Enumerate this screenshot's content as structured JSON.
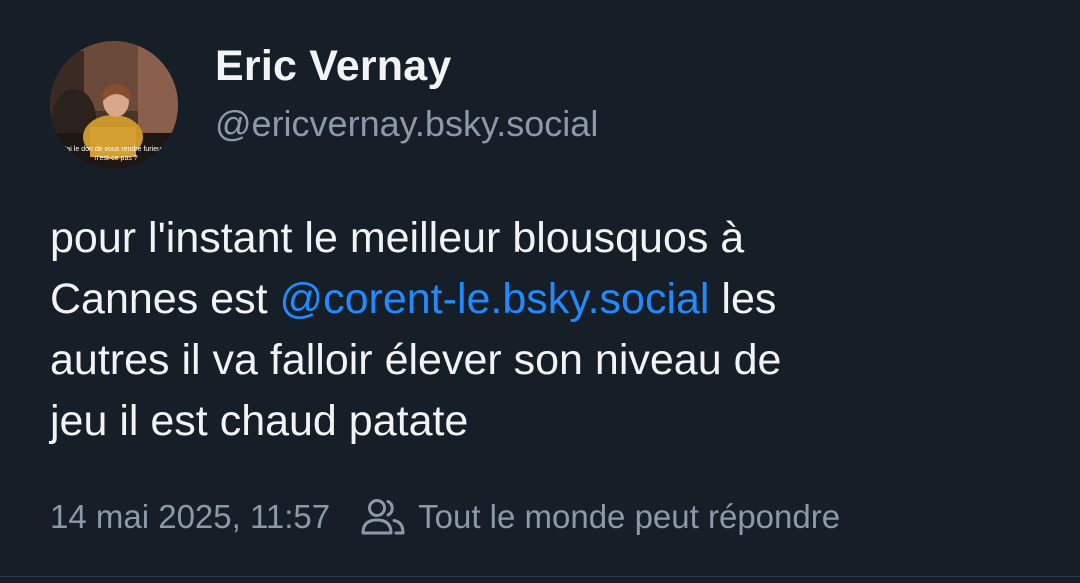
{
  "author": {
    "display_name": "Eric Vernay",
    "handle": "@ericvernay.bsky.social",
    "avatar_caption_line1": "J'ai le don de vous rendre furieux,",
    "avatar_caption_line2": "n'est-ce pas ?"
  },
  "post": {
    "text_line1": "pour l'instant le meilleur blousquos à",
    "text_line2_before": "Cannes est ",
    "mention": "@corent-le.bsky.social",
    "text_line2_after": " les",
    "text_line3": "autres il va falloir élever son niveau de",
    "text_line4": "jeu il est chaud patate"
  },
  "meta": {
    "timestamp": "14 mai 2025, 11:57",
    "reply_setting": "Tout le monde peut répondre",
    "reply_icon": "people-icon"
  },
  "colors": {
    "background": "#161e27",
    "text": "#f1f3f5",
    "muted": "#8d99a8",
    "link": "#208bfe"
  }
}
